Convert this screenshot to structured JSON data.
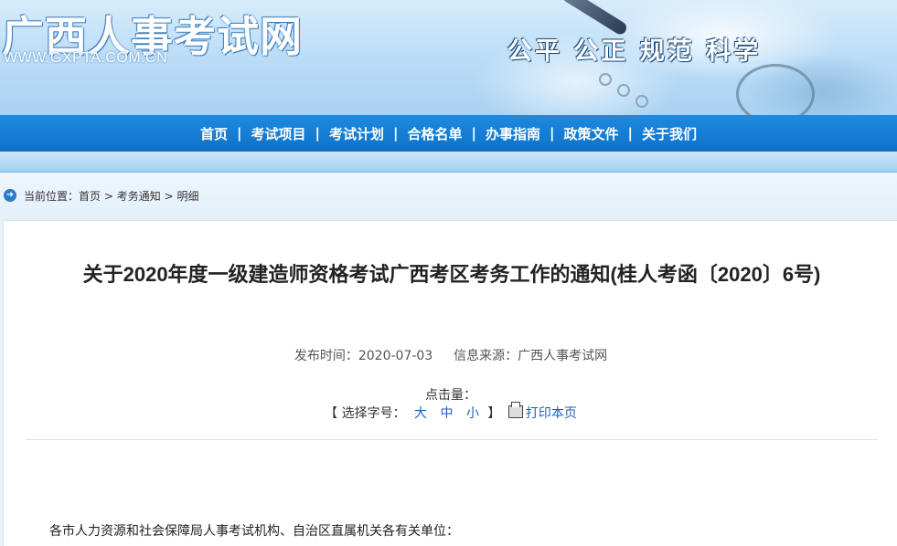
{
  "header": {
    "site_title": "广西人事考试网",
    "site_url": "WWW.GXPTA.COM.CN",
    "slogan": "公平 公正 规范 科学"
  },
  "nav": {
    "items": [
      {
        "label": "首页"
      },
      {
        "label": "考试项目"
      },
      {
        "label": "考试计划"
      },
      {
        "label": "合格名单"
      },
      {
        "label": "办事指南"
      },
      {
        "label": "政策文件"
      },
      {
        "label": "关于我们"
      }
    ],
    "separator": "|"
  },
  "breadcrumb": {
    "prefix": "当前位置：",
    "items": [
      "首页",
      "考务通知",
      "明细"
    ],
    "separator": ">"
  },
  "article": {
    "title": "关于2020年度一级建造师资格考试广西考区考务工作的通知(桂人考函〔2020〕6号)",
    "publish_label": "发布时间：",
    "publish_date": "2020-07-03",
    "source_label": "信息来源：",
    "source": "广西人事考试网",
    "hits_label": "点击量：",
    "font_size_open": "【 选择字号：",
    "font_size_options": [
      "大",
      "中",
      "小"
    ],
    "font_size_close": "】",
    "print_label": "打印本页",
    "first_line": "各市人力资源和社会保障局人事考试机构、自治区直属机关各有关单位："
  },
  "colors": {
    "nav_bg": "#0c72c8",
    "link": "#1a62b0"
  }
}
